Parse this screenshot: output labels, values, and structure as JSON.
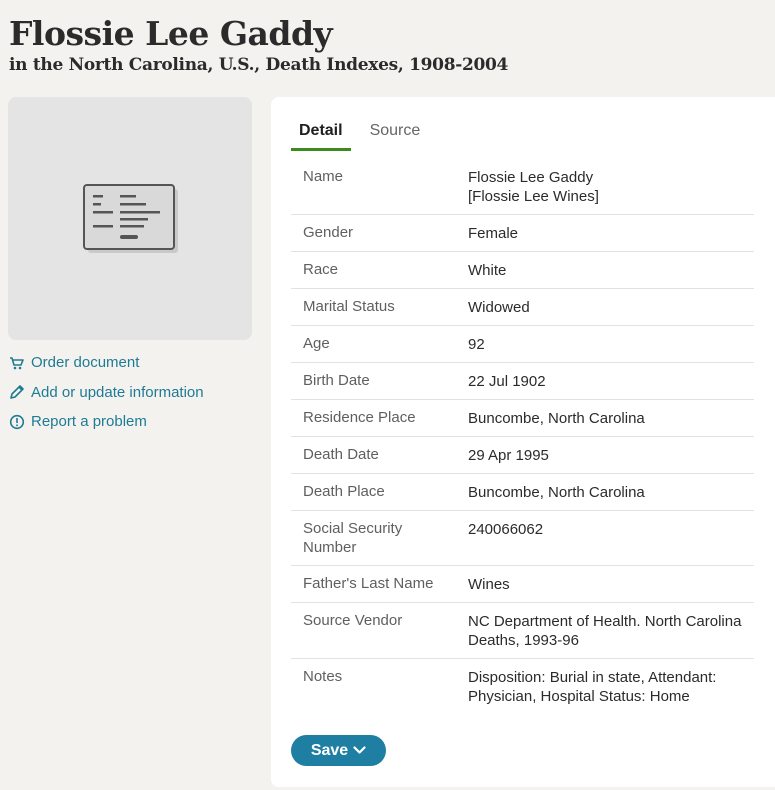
{
  "header": {
    "title": "Flossie Lee Gaddy",
    "subtitle": "in the North Carolina, U.S., Death Indexes, 1908-2004"
  },
  "sidebar": {
    "thumbnail_icon": "document-card-icon",
    "links": [
      {
        "label": "Order document",
        "icon": "cart-icon"
      },
      {
        "label": "Add or update information",
        "icon": "pencil-icon"
      },
      {
        "label": "Report a problem",
        "icon": "alert-circle-icon"
      }
    ]
  },
  "tabs": [
    {
      "label": "Detail",
      "active": true
    },
    {
      "label": "Source",
      "active": false
    }
  ],
  "details": [
    {
      "label": "Name",
      "value": "Flossie Lee Gaddy\n[Flossie Lee Wines]"
    },
    {
      "label": "Gender",
      "value": "Female"
    },
    {
      "label": "Race",
      "value": "White"
    },
    {
      "label": "Marital Status",
      "value": "Widowed"
    },
    {
      "label": "Age",
      "value": "92"
    },
    {
      "label": "Birth Date",
      "value": "22 Jul 1902"
    },
    {
      "label": "Residence Place",
      "value": "Buncombe, North Carolina"
    },
    {
      "label": "Death Date",
      "value": "29 Apr 1995"
    },
    {
      "label": "Death Place",
      "value": "Buncombe, North Carolina"
    },
    {
      "label": "Social Security Number",
      "value": "240066062"
    },
    {
      "label": "Father's Last Name",
      "value": "Wines"
    },
    {
      "label": "Source Vendor",
      "value": "NC Department of Health. North Carolina Deaths, 1993-96"
    },
    {
      "label": "Notes",
      "value": "Disposition: Burial in state, Attendant: Physician, Hospital Status: Home"
    }
  ],
  "save_button": {
    "label": "Save",
    "icon": "chevron-down-icon"
  },
  "colors": {
    "accent": "#1e7fa3",
    "link": "#1e7b94",
    "tab_underline": "#3d8a1f",
    "background": "#f4f2ef"
  }
}
